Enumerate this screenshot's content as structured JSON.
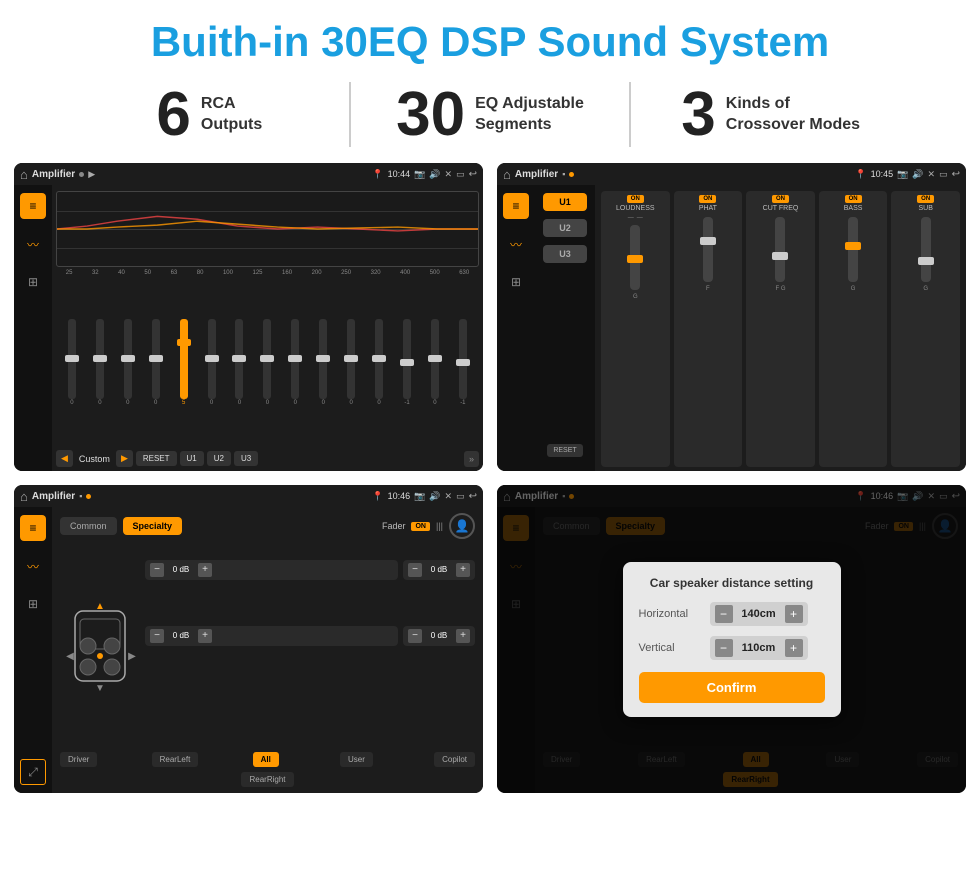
{
  "header": {
    "title": "Buith-in 30EQ DSP Sound System"
  },
  "stats": [
    {
      "number": "6",
      "text": "RCA\nOutputs"
    },
    {
      "number": "30",
      "text": "EQ Adjustable\nSegments"
    },
    {
      "number": "3",
      "text": "Kinds of\nCrossover Modes"
    }
  ],
  "screens": [
    {
      "title": "Amplifier",
      "time": "10:44",
      "type": "eq"
    },
    {
      "title": "Amplifier",
      "time": "10:45",
      "type": "amp"
    },
    {
      "title": "Amplifier",
      "time": "10:46",
      "type": "speaker"
    },
    {
      "title": "Amplifier",
      "time": "10:46",
      "type": "dialog"
    }
  ],
  "eq": {
    "freqs": [
      "25",
      "32",
      "40",
      "50",
      "63",
      "80",
      "100",
      "125",
      "160",
      "200",
      "250",
      "320",
      "400",
      "500",
      "630"
    ],
    "values": [
      "0",
      "0",
      "0",
      "0",
      "5",
      "0",
      "0",
      "0",
      "0",
      "0",
      "0",
      "0",
      "-1",
      "0",
      "-1"
    ],
    "preset": "Custom",
    "buttons": [
      "RESET",
      "U1",
      "U2",
      "U3"
    ]
  },
  "amp": {
    "units": [
      "U1",
      "U2",
      "U3"
    ],
    "controls": [
      "LOUDNESS",
      "PHAT",
      "CUT FREQ",
      "BASS",
      "SUB"
    ]
  },
  "speaker": {
    "tabs": [
      "Common",
      "Specialty"
    ],
    "fader_label": "Fader",
    "fader_on": "ON",
    "db_values": [
      "0 dB",
      "0 dB",
      "0 dB",
      "0 dB"
    ],
    "labels": [
      "Driver",
      "RearLeft",
      "All",
      "User",
      "RearRight",
      "Copilot"
    ]
  },
  "dialog": {
    "title": "Car speaker distance setting",
    "horizontal_label": "Horizontal",
    "horizontal_value": "140cm",
    "vertical_label": "Vertical",
    "vertical_value": "110cm",
    "confirm_label": "Confirm"
  }
}
